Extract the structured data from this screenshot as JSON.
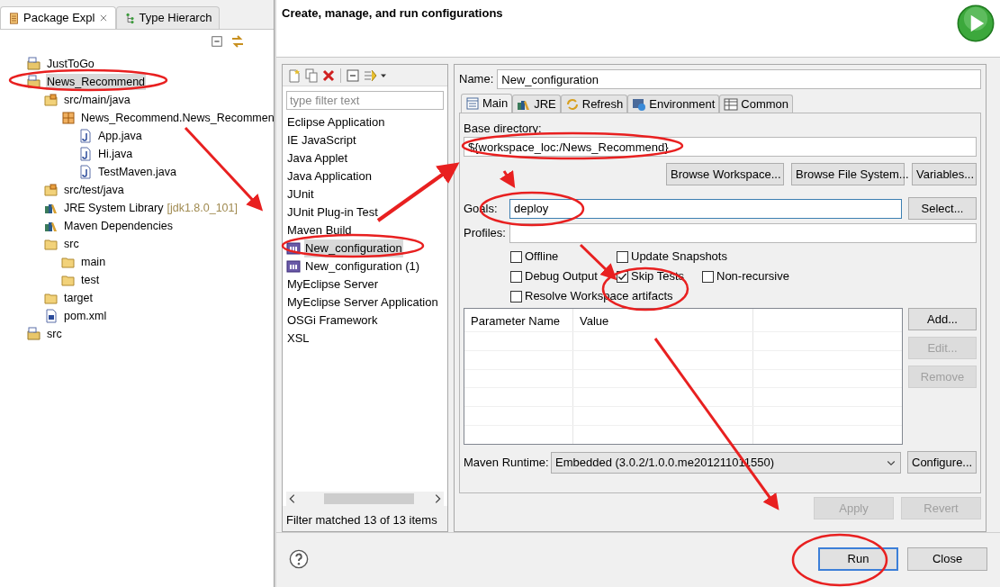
{
  "package_explorer": {
    "tabs": [
      {
        "label": "Package Expl",
        "selected": true,
        "closable": true
      },
      {
        "label": "Type Hierarch",
        "selected": false,
        "closable": false
      }
    ],
    "tree": [
      {
        "label": "JustToGo",
        "kind": "project",
        "selected": false
      },
      {
        "label": "News_Recommend",
        "kind": "project",
        "selected": true,
        "children": [
          {
            "label": "src/main/java",
            "kind": "source_folder",
            "selected": false,
            "children": [
              {
                "label": "News_Recommend.News_Recommen",
                "kind": "package",
                "selected": false,
                "children": [
                  {
                    "label": "App.java",
                    "kind": "java_file",
                    "selected": false
                  },
                  {
                    "label": "Hi.java",
                    "kind": "java_file",
                    "selected": false
                  },
                  {
                    "label": "TestMaven.java",
                    "kind": "java_file",
                    "selected": false
                  }
                ]
              }
            ]
          },
          {
            "label": "src/test/java",
            "kind": "source_folder",
            "selected": false
          },
          {
            "label": "JRE System Library",
            "decoration": "[jdk1.8.0_101]",
            "kind": "library",
            "selected": false
          },
          {
            "label": "Maven Dependencies",
            "kind": "library",
            "selected": false
          },
          {
            "label": "src",
            "kind": "folder",
            "selected": false,
            "children": [
              {
                "label": "main",
                "kind": "folder",
                "selected": false
              },
              {
                "label": "test",
                "kind": "folder",
                "selected": false
              }
            ]
          },
          {
            "label": "target",
            "kind": "folder",
            "selected": false
          },
          {
            "label": "pom.xml",
            "kind": "xml_file",
            "selected": false
          }
        ]
      },
      {
        "label": "src",
        "kind": "project",
        "selected": false
      }
    ]
  },
  "dialog": {
    "title": "Create, manage, and run configurations",
    "filter": {
      "placeholder": "type filter text"
    },
    "configurations": [
      {
        "label": "Eclipse Application",
        "kind": "category",
        "selected": false
      },
      {
        "label": "IE JavaScript",
        "kind": "category",
        "selected": false
      },
      {
        "label": "Java Applet",
        "kind": "category",
        "selected": false
      },
      {
        "label": "Java Application",
        "kind": "category",
        "selected": false
      },
      {
        "label": "JUnit",
        "kind": "category",
        "selected": false
      },
      {
        "label": "JUnit Plug-in Test",
        "kind": "category",
        "selected": false
      },
      {
        "label": "Maven Build",
        "kind": "category",
        "selected": false
      },
      {
        "label": "New_configuration",
        "kind": "maven_config",
        "selected": true
      },
      {
        "label": "New_configuration (1)",
        "kind": "maven_config",
        "selected": false
      },
      {
        "label": "MyEclipse Server",
        "kind": "category",
        "selected": false
      },
      {
        "label": "MyEclipse Server Application",
        "kind": "category",
        "selected": false
      },
      {
        "label": "OSGi Framework",
        "kind": "category",
        "selected": false
      },
      {
        "label": "XSL",
        "kind": "category",
        "selected": false
      }
    ],
    "filter_status": "Filter matched 13 of 13 items",
    "name": {
      "label": "Name:",
      "value": "New_configuration"
    },
    "tabs": [
      {
        "label": "Main",
        "kind": "main",
        "selected": true
      },
      {
        "label": "JRE",
        "kind": "jre",
        "selected": false
      },
      {
        "label": "Refresh",
        "kind": "refresh",
        "selected": false
      },
      {
        "label": "Environment",
        "kind": "environment",
        "selected": false
      },
      {
        "label": "Common",
        "kind": "common",
        "selected": false
      }
    ],
    "base_directory": {
      "label": "Base directory:",
      "value": "${workspace_loc:/News_Recommend}"
    },
    "directory_buttons": [
      "Browse Workspace...",
      "Browse File System...",
      "Variables..."
    ],
    "goals": {
      "label": "Goals:",
      "value": "deploy",
      "button": "Select..."
    },
    "profiles": {
      "label": "Profiles:"
    },
    "option_rows": [
      [
        {
          "label": "Offline",
          "checked": false
        },
        {
          "label": "Update Snapshots",
          "checked": false
        }
      ],
      [
        {
          "label": "Debug Output",
          "checked": false
        },
        {
          "label": "Skip Tests",
          "checked": true
        },
        {
          "label": "Non-recursive",
          "checked": false
        }
      ],
      [
        {
          "label": "Resolve Workspace artifacts",
          "checked": false
        }
      ]
    ],
    "parameters": {
      "columns": [
        "Parameter Name",
        "Value"
      ],
      "buttons": [
        {
          "label": "Add...",
          "disabled": false
        },
        {
          "label": "Edit...",
          "disabled": true
        },
        {
          "label": "Remove",
          "disabled": true
        }
      ]
    },
    "maven_runtime": {
      "label": "Maven Runtime:",
      "value": "Embedded (3.0.2/1.0.0.me201211011550)",
      "button": "Configure..."
    },
    "apply_buttons": [
      {
        "label": "Apply",
        "disabled": true
      },
      {
        "label": "Revert",
        "disabled": true
      }
    ],
    "footer_buttons": [
      {
        "label": "Run",
        "default": true
      },
      {
        "label": "Close",
        "default": false
      }
    ]
  }
}
